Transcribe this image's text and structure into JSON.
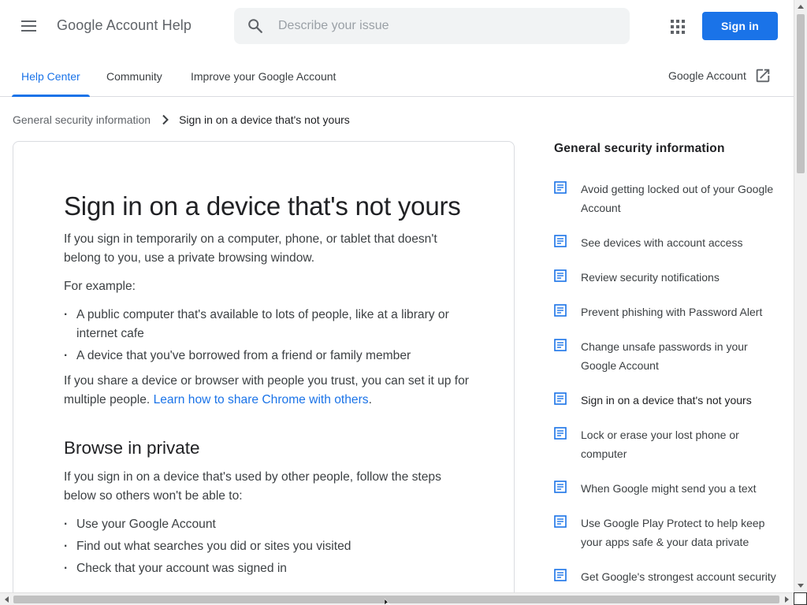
{
  "header": {
    "app_title": "Google Account Help",
    "search_placeholder": "Describe your issue",
    "sign_in_label": "Sign in"
  },
  "nav": {
    "tabs": [
      {
        "label": "Help Center",
        "active": true
      },
      {
        "label": "Community",
        "active": false
      },
      {
        "label": "Improve your Google Account",
        "active": false
      }
    ],
    "account_link": "Google Account"
  },
  "breadcrumb": {
    "parent": "General security information",
    "current": "Sign in on a device that's not yours"
  },
  "article": {
    "title": "Sign in on a device that's not yours",
    "intro": "If you sign in temporarily on a computer, phone, or tablet that doesn't belong to you, use a private browsing window.",
    "example_label": "For example:",
    "examples": [
      "A public computer that's available to lots of people, like at a library or internet cafe",
      "A device that you've borrowed from a friend or family member"
    ],
    "share_text": "If you share a device or browser with people you trust, you can set it up for multiple people. ",
    "share_link": "Learn how to share Chrome with others",
    "share_end": ".",
    "section_title": "Browse in private",
    "browse_text": "If you sign in on a device that's used by other people, follow the steps below so others won't be able to:",
    "browse_items": [
      "Use your Google Account",
      "Find out what searches you did or sites you visited",
      "Check that your account was signed in"
    ]
  },
  "sidebar": {
    "title": "General security information",
    "items": [
      {
        "label": "Avoid getting locked out of your Google Account",
        "current": false
      },
      {
        "label": "See devices with account access",
        "current": false
      },
      {
        "label": "Review security notifications",
        "current": false
      },
      {
        "label": "Prevent phishing with Password Alert",
        "current": false
      },
      {
        "label": "Change unsafe passwords in your Google Account",
        "current": false
      },
      {
        "label": "Sign in on a device that's not yours",
        "current": true
      },
      {
        "label": "Lock or erase your lost phone or computer",
        "current": false
      },
      {
        "label": "When Google might send you a text",
        "current": false
      },
      {
        "label": "Use Google Play Protect to help keep your apps safe & your data private",
        "current": false
      },
      {
        "label": "Get Google's strongest account security",
        "current": false
      }
    ]
  },
  "colors": {
    "accent": "#1a73e8",
    "text_primary": "#202124",
    "text_secondary": "#5f6368"
  },
  "icons": {
    "menu": "hamburger-menu-icon",
    "search": "search-icon",
    "apps": "apps-grid-icon",
    "external": "open-in-new-icon",
    "chevron": "chevron-right-icon",
    "article": "article-doc-icon"
  }
}
